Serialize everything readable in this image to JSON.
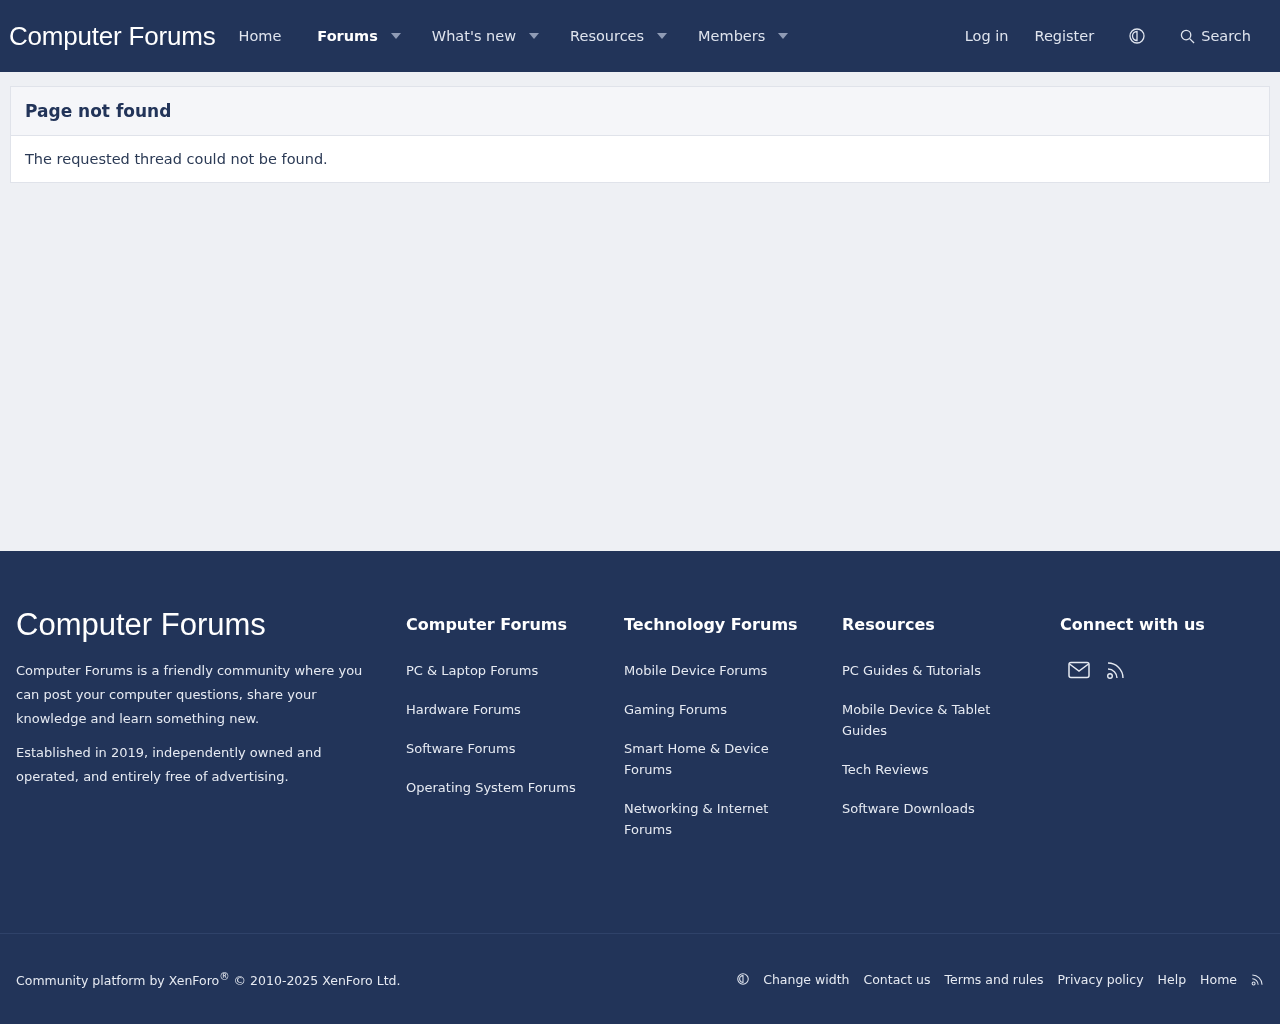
{
  "header": {
    "logo": "Computer Forums",
    "nav": [
      {
        "label": "Home",
        "selected": false,
        "dropdown": false
      },
      {
        "label": "Forums",
        "selected": true,
        "dropdown": true
      },
      {
        "label": "What's new",
        "selected": false,
        "dropdown": true
      },
      {
        "label": "Resources",
        "selected": false,
        "dropdown": true
      },
      {
        "label": "Members",
        "selected": false,
        "dropdown": true
      }
    ],
    "account": [
      "Log in",
      "Register"
    ],
    "search": "Search"
  },
  "notice": {
    "title": "Page not found",
    "message": "The requested thread could not be found."
  },
  "footer": {
    "logo": "Computer Forums",
    "about": [
      "Computer Forums is a friendly community where you can post your computer questions, share your knowledge and learn something new.",
      "Established in 2019, independently owned and operated, and entirely free of advertising."
    ],
    "columns": [
      {
        "title": "Computer Forums",
        "links": [
          "PC & Laptop Forums",
          "Hardware Forums",
          "Software Forums",
          "Operating System Forums"
        ]
      },
      {
        "title": "Technology Forums",
        "links": [
          "Mobile Device Forums",
          "Gaming Forums",
          "Smart Home & Device Forums",
          "Networking & Internet Forums"
        ]
      },
      {
        "title": "Resources",
        "links": [
          "PC Guides & Tutorials",
          "Mobile Device & Tablet Guides",
          "Tech Reviews",
          "Software Downloads"
        ]
      }
    ],
    "connect": {
      "title": "Connect with us"
    },
    "copyright": "Community platform by XenForo$^{®}$ © 2010-2025 XenForo Ltd.",
    "links": [
      "Change width",
      "Contact us",
      "Terms and rules",
      "Privacy policy",
      "Help",
      "Home"
    ]
  }
}
